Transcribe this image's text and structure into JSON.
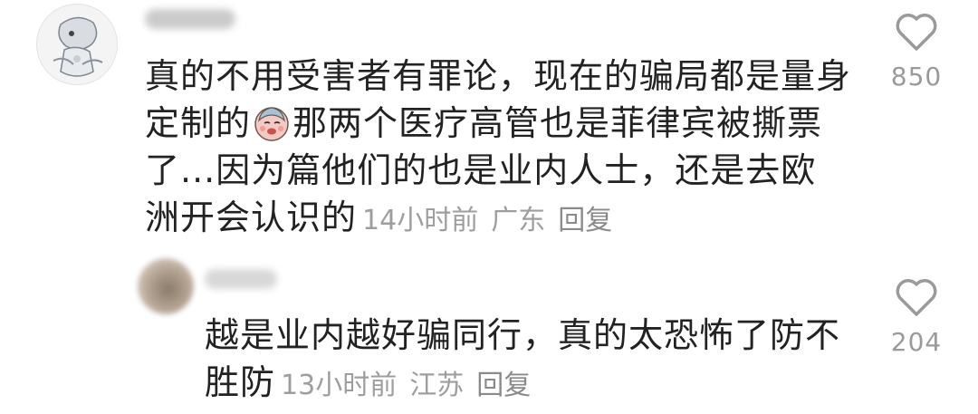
{
  "comments": [
    {
      "text_before_emoji": "真的不用受害者有罪论，现在的骗局都是量身定制的",
      "emoji": "crying-face-emoji",
      "text_after_emoji": "那两个医疗高管也是菲律宾被撕票了...因为篇他们的也是业内人士，还是去欧洲开会认识的",
      "time": "14小时前",
      "location": "广东",
      "reply_label": "回复",
      "like_count": "850"
    },
    {
      "text": "越是业内越好骗同行，真的太恐怖了防不胜防",
      "time": "13小时前",
      "location": "江苏",
      "reply_label": "回复",
      "like_count": "204"
    }
  ],
  "colors": {
    "text": "#222222",
    "meta": "#9e9e9e",
    "icon": "#9a9a9a"
  }
}
